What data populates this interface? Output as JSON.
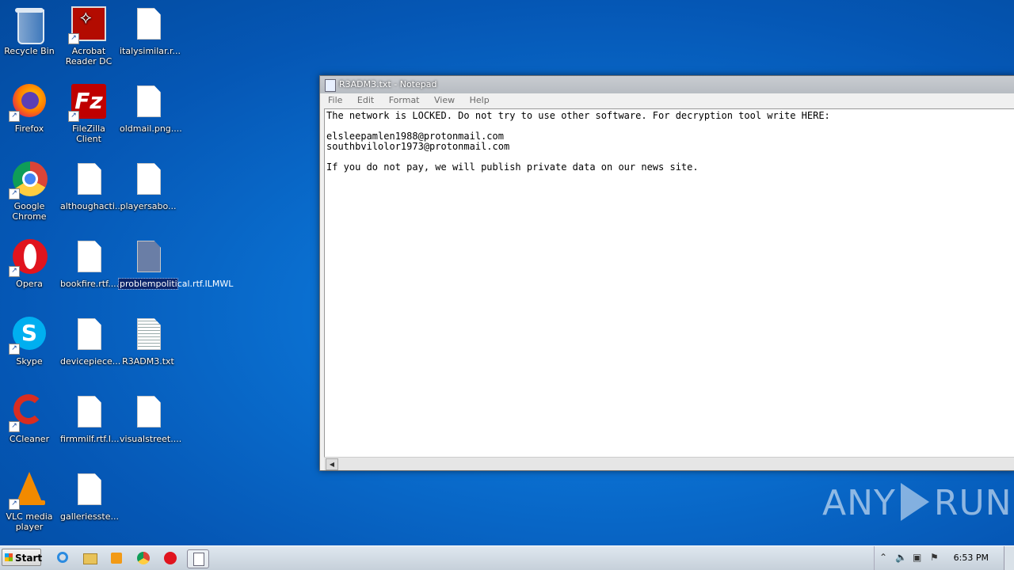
{
  "desktop": {
    "icons": [
      {
        "label": "Recycle Bin"
      },
      {
        "label": "Acrobat Reader DC"
      },
      {
        "label": "italysimilar.r..."
      },
      {
        "label": "Firefox"
      },
      {
        "label": "FileZilla Client"
      },
      {
        "label": "oldmail.png...."
      },
      {
        "label": "Google Chrome"
      },
      {
        "label": "althoughacti..."
      },
      {
        "label": "playersabo..."
      },
      {
        "label": "Opera"
      },
      {
        "label": "bookfire.rtf...."
      },
      {
        "label": "problempolitical.rtf.ILMWL"
      },
      {
        "label": "Skype"
      },
      {
        "label": "devicepiece..."
      },
      {
        "label": "R3ADM3.txt"
      },
      {
        "label": "CCleaner"
      },
      {
        "label": "firmmilf.rtf.I..."
      },
      {
        "label": "visualstreet...."
      },
      {
        "label": "VLC media player"
      },
      {
        "label": "galleriesste..."
      }
    ]
  },
  "notepad": {
    "title": "R3ADM3.txt - Notepad",
    "menu": [
      "File",
      "Edit",
      "Format",
      "View",
      "Help"
    ],
    "content": "The network is LOCKED. Do not try to use other software. For decryption tool write HERE:\n\nelsleepamlen1988@protonmail.com\nsouthbvilolor1973@protonmail.com\n\nIf you do not pay, we will publish private data on our news site."
  },
  "taskbar": {
    "start_label": "Start",
    "clock": "6:53 PM"
  },
  "watermark": {
    "left": "ANY",
    "right": "RUN"
  }
}
